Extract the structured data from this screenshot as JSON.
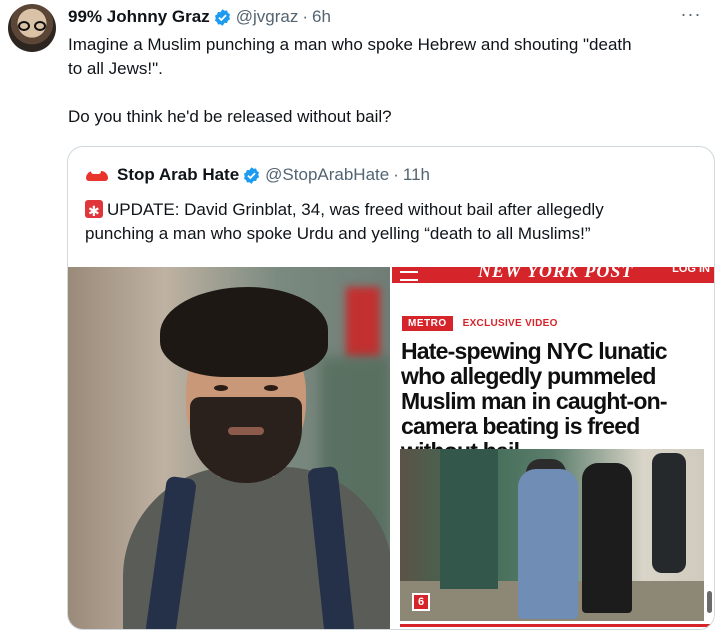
{
  "tweet": {
    "author": {
      "display_name": "99% Johnny Graz",
      "handle": "@jvgraz",
      "time": "6h",
      "verified": true
    },
    "text_lines": [
      "Imagine a Muslim punching a man who spoke Hebrew and shouting \"death",
      "to all Jews!\"."
    ],
    "text_second_paragraph": "Do you think he'd be released without bail?",
    "more_icon": "more-dots-icon"
  },
  "quote": {
    "author": {
      "display_name": "Stop Arab Hate",
      "handle": "@StopArabHate",
      "time": "11h",
      "verified": true
    },
    "text_line1": "UPDATE: David Grinblat, 34, was freed without bail after allegedly",
    "text_line2": "punching a man who spoke Urdu and yelling “death to all Muslims!”",
    "siren_icon": "siren-icon"
  },
  "nypost": {
    "logo": "NEW YORK POST",
    "login": "LOG IN",
    "tag": "METRO",
    "label": "EXCLUSIVE VIDEO",
    "headline": "Hate-spewing NYC lunatic who allegedly pummeled Muslim man in caught-on-camera beating is freed without bail",
    "photo_badge": "6"
  },
  "colors": {
    "verified_blue": "#1d9bf0",
    "nypost_red": "#d6242b",
    "secondary_text": "#536471"
  }
}
